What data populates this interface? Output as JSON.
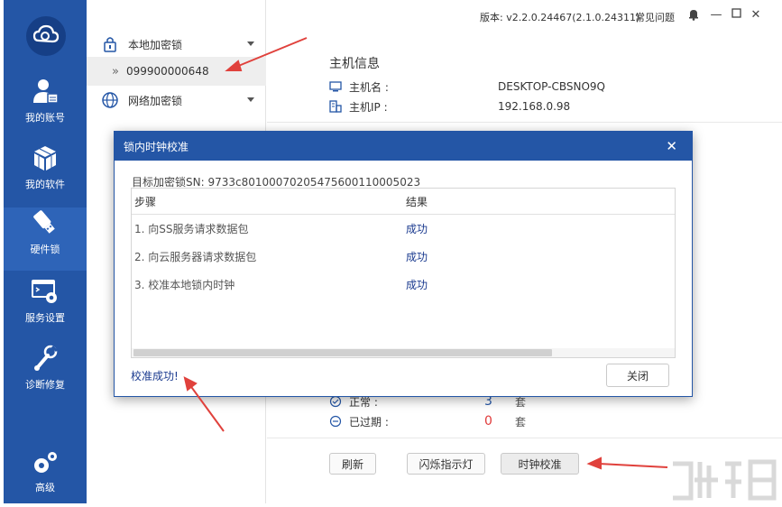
{
  "window": {
    "version": "版本: v2.2.0.24467(2.1.0.24311)",
    "faq": "常见问题"
  },
  "nav": {
    "items": [
      {
        "label": "我的账号",
        "icon": "user-icon"
      },
      {
        "label": "我的软件",
        "icon": "cube-icon"
      },
      {
        "label": "硬件锁",
        "icon": "usb-key-icon",
        "active": true
      },
      {
        "label": "服务设置",
        "icon": "service-settings-icon"
      },
      {
        "label": "诊断修复",
        "icon": "wrench-icon"
      }
    ],
    "advanced": "高级"
  },
  "tree": {
    "local_lock": "本地加密锁",
    "local_lock_id": "099900000648",
    "network_lock": "网络加密锁"
  },
  "host": {
    "title": "主机信息",
    "name_label": "主机名 :",
    "name_value": "DESKTOP-CBSNO9Q",
    "ip_label": "主机IP :",
    "ip_value": "192.168.0.98"
  },
  "status": {
    "normal_label": "正常 :",
    "normal_count": "3",
    "expired_label": "已过期 :",
    "expired_count": "0",
    "unit": "套"
  },
  "actions": {
    "refresh": "刷新",
    "blink": "闪烁指示灯",
    "calibrate": "时钟校准"
  },
  "dialog": {
    "title": "锁内时钟校准",
    "target": "目标加密锁SN: 9733c80100070205475600110005023",
    "col_step": "步骤",
    "col_result": "结果",
    "rows": [
      {
        "step": "1. 向SS服务请求数据包",
        "result": "成功"
      },
      {
        "step": "2. 向云服务器请求数据包",
        "result": "成功"
      },
      {
        "step": "3. 校准本地锁内时钟",
        "result": "成功"
      }
    ],
    "message": "校准成功!",
    "close": "关闭"
  },
  "colors": {
    "nav_bg": "#2456a6",
    "accent_link": "#1a3a8f",
    "expired": "#e03a3a",
    "normal": "#2456a6",
    "arrow": "#e0413c"
  }
}
